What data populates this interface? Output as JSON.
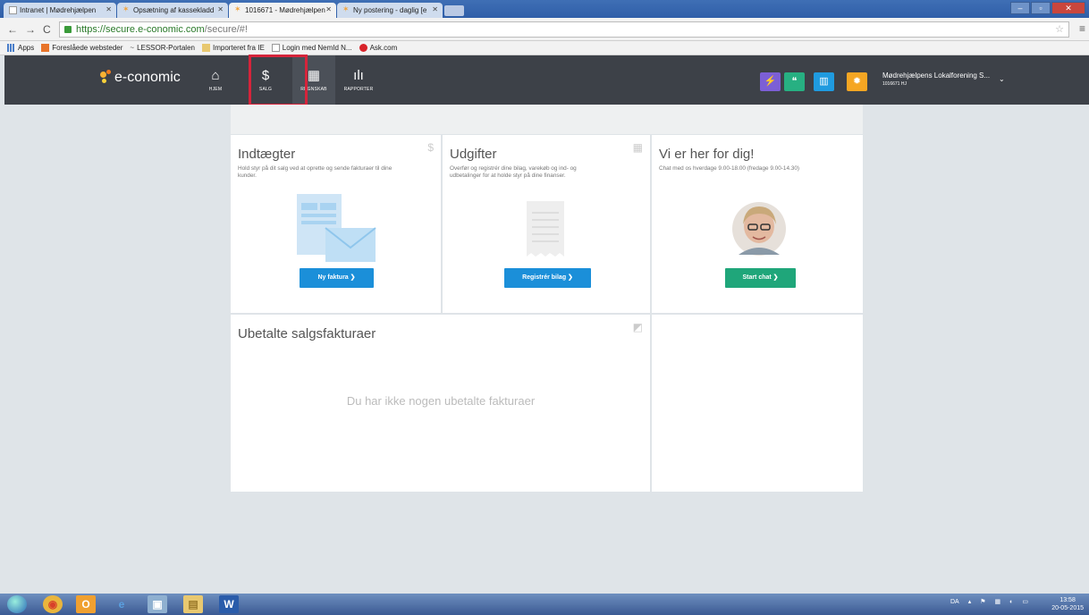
{
  "browser": {
    "tabs": [
      {
        "label": "Intranet | Mødrehjælpen",
        "active": false
      },
      {
        "label": "Opsætning af kassekladd",
        "active": false
      },
      {
        "label": "1016671 - Mødrehjælpen",
        "active": true
      },
      {
        "label": "Ny postering - daglig [e",
        "active": false
      }
    ],
    "url_host": "https://secure.e-conomic.com",
    "url_path": "/secure/#!",
    "bookmarks": [
      "Apps",
      "Foreslåede websteder",
      "LESSOR-Portalen",
      "Importeret fra IE",
      "Login med NemId N...",
      "Ask.com"
    ]
  },
  "app": {
    "logo": "e-conomic",
    "nav": [
      {
        "label": "HJEM",
        "icon": "home-icon",
        "glyph": "⌂"
      },
      {
        "label": "SALG",
        "icon": "dollar-icon",
        "glyph": "$"
      },
      {
        "label": "REGNSKAB",
        "icon": "calculator-icon",
        "glyph": "▦"
      },
      {
        "label": "RAPPORTER",
        "icon": "bar-chart-icon",
        "glyph": "ılı"
      }
    ],
    "header_buttons": [
      {
        "icon": "lightning-icon",
        "glyph": "⚡",
        "color": "#7c5fd6"
      },
      {
        "icon": "chat-icon",
        "glyph": "❝",
        "color": "#27b082"
      },
      {
        "icon": "book-icon",
        "glyph": "▥",
        "color": "#1f9be0"
      },
      {
        "icon": "gear-icon",
        "glyph": "✹",
        "color": "#f5a623"
      }
    ],
    "company_name": "Mødrehjælpens Lokalforening S...",
    "company_id": "1016671 HJ"
  },
  "dashboard": {
    "income": {
      "title": "Indtægter",
      "desc1": "Hold styr på dit salg ved at oprette og sende fakturaer til dine",
      "desc2": "kunder.",
      "button": "Ny faktura  ❯",
      "button_color": "#1b8fd9"
    },
    "expenses": {
      "title": "Udgifter",
      "desc1": "Overfør og registrér dine bilag, varekøb og ind- og",
      "desc2": "udbetalinger for at holde styr på dine finanser.",
      "button": "Registrér bilag  ❯",
      "button_color": "#1b8fd9"
    },
    "support": {
      "title": "Vi er her for dig!",
      "desc1": "Chat med os hverdage 9.00-18.00 (fredage 9.00-14.30)",
      "button": "Start chat  ❯",
      "button_color": "#1fa67a"
    },
    "unpaid": {
      "title": "Ubetalte salgsfakturaer",
      "empty": "Du har ikke nogen ubetalte fakturaer"
    }
  },
  "taskbar": {
    "apps": [
      {
        "icon": "chrome-icon",
        "glyph": "◉",
        "color": "#e9b53d"
      },
      {
        "icon": "outlook-icon",
        "glyph": "O",
        "color": "#f0a030"
      },
      {
        "icon": "ie-icon",
        "glyph": "e",
        "color": "#5aa0e0"
      },
      {
        "icon": "photo-viewer-icon",
        "glyph": "▣",
        "color": "#8fb0d0"
      },
      {
        "icon": "folder-icon",
        "glyph": "▤",
        "color": "#e8c870"
      },
      {
        "icon": "word-icon",
        "glyph": "W",
        "color": "#2a5caa"
      }
    ],
    "lang": "DA",
    "time": "13:58",
    "date": "20-05-2015"
  }
}
